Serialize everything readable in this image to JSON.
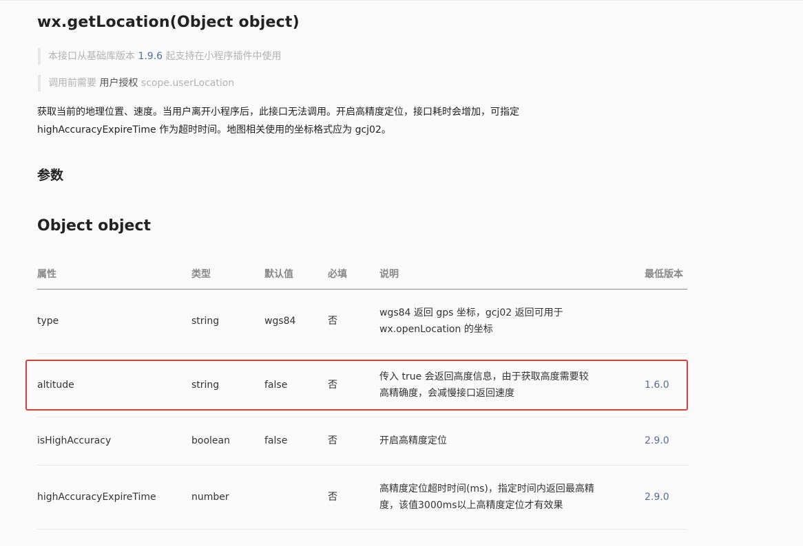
{
  "header": {
    "title": "wx.getLocation(Object object)"
  },
  "notes": {
    "support_prefix": "本接口从基础库版本",
    "support_version": "1.9.6",
    "support_suffix": "起支持在小程序插件中使用",
    "auth_prefix": "调用前需要",
    "auth_link": "用户授权",
    "auth_scope": "scope.userLocation"
  },
  "description": {
    "line1": "获取当前的地理位置、速度。当用户离开小程序后，此接口无法调用。开启高精度定位，接口耗时会增加，可指定",
    "line2": "highAccuracyExpireTime 作为超时时间。地图相关使用的坐标格式应为 gcj02。"
  },
  "sections": {
    "params": "参数",
    "object": "Object object"
  },
  "table": {
    "headers": [
      "属性",
      "类型",
      "默认值",
      "必填",
      "说明",
      "最低版本"
    ],
    "rows": [
      {
        "name": "type",
        "type": "string",
        "default": "wgs84",
        "required": "否",
        "desc1": "wgs84 返回 gps 坐标，gcj02 返回可用于",
        "desc2": "wx.openLocation 的坐标",
        "version": ""
      },
      {
        "name": "altitude",
        "type": "string",
        "default": "false",
        "required": "否",
        "desc1": "传入 true 会返回高度信息，由于获取高度需要较",
        "desc2": "高精确度，会减慢接口返回速度",
        "version": "1.6.0"
      },
      {
        "name": "isHighAccuracy",
        "type": "boolean",
        "default": "false",
        "required": "否",
        "desc1": "开启高精度定位",
        "desc2": "",
        "version": "2.9.0"
      },
      {
        "name": "highAccuracyExpireTime",
        "type": "number",
        "default": "",
        "required": "否",
        "desc1": "高精度定位超时时间(ms)，指定时间内返回最高精",
        "desc2": "度，该值3000ms以上高精度定位才有效果",
        "version": "2.9.0"
      }
    ]
  },
  "colors": {
    "link": "#576b95",
    "highlight_border": "#e03a3a"
  }
}
